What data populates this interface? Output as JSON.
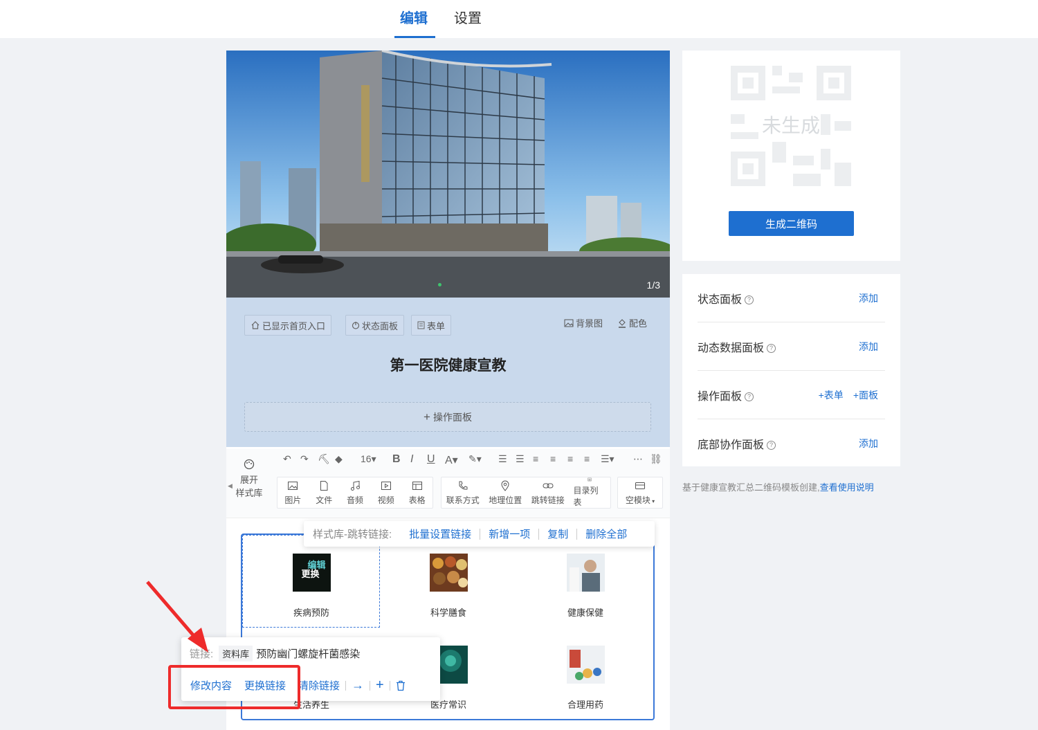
{
  "tabs": {
    "edit": "编辑",
    "settings": "设置"
  },
  "banner": {
    "counter": "1/3"
  },
  "header": {
    "chip_home": "已显示首页入口",
    "chip_status": "状态面板",
    "chip_form": "表单",
    "bg_btn": "背景图",
    "color_btn": "配色",
    "title": "第一医院健康宣教",
    "op_panel": "操作面板"
  },
  "toolbar": {
    "expand_line1": "展开",
    "expand_line2": "样式库",
    "font_size": "16",
    "tools": [
      "图片",
      "文件",
      "音频",
      "视频",
      "表格",
      "联系方式",
      "地理位置",
      "跳转链接",
      "目录列表",
      "空模块"
    ]
  },
  "popup_top": {
    "label": "样式库-跳转链接:",
    "batch": "批量设置链接",
    "add": "新增一项",
    "copy": "复制",
    "delete_all": "删除全部"
  },
  "grid": {
    "items": [
      "疾病预防",
      "科学膳食",
      "健康保健",
      "生活养生",
      "医疗常识",
      "合理用药"
    ],
    "thumb_overlay_edit": "编辑",
    "thumb_overlay_replace": "更换"
  },
  "popup_bottom": {
    "link_label": "链接:",
    "badge": "资料库",
    "link_text": "预防幽门螺旋杆菌感染",
    "modify": "修改内容",
    "replace": "更换链接",
    "clear": "清除链接"
  },
  "qr": {
    "placeholder": "未生成",
    "button": "生成二维码"
  },
  "panels": [
    {
      "name": "状态面板",
      "action": "添加"
    },
    {
      "name": "动态数据面板",
      "action": "添加"
    },
    {
      "name": "操作面板",
      "action": "",
      "action1": "+表单",
      "action2": "+面板"
    },
    {
      "name": "底部协作面板",
      "action": "添加"
    }
  ],
  "note": {
    "text": "基于健康宣教汇总二维码模板创建,",
    "link": "查看使用说明"
  },
  "colors": {
    "accent": "#1e6fd0",
    "highlight": "#ee2b2b",
    "header_bg": "#c9d9ec"
  }
}
